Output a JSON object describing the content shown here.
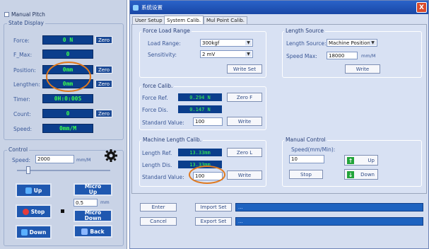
{
  "left": {
    "manual_pitch": "Manual Pitch",
    "state_display": "State Display",
    "rows": [
      {
        "label": "Force:",
        "value": "0 N",
        "zero": "Zero"
      },
      {
        "label": "F_Max:",
        "value": "0",
        "zero": ""
      },
      {
        "label": "Position:",
        "value": "0mm",
        "zero": "Zero"
      },
      {
        "label": "Lengthen:",
        "value": "0mm",
        "zero": "Zero"
      },
      {
        "label": "Timer:",
        "value": "0H:0:00S",
        "zero": ""
      },
      {
        "label": "Count:",
        "value": "0",
        "zero": "Zero"
      },
      {
        "label": "Speed:",
        "value": "0mm/M",
        "zero": ""
      }
    ],
    "control": {
      "title": "Control",
      "speed_label": "Speed:",
      "speed_value": "2000",
      "speed_unit": "mm/M",
      "slider_level": 0.12,
      "micro_value": "0.5",
      "micro_unit": "mm",
      "up": "Up",
      "stop": "Stop",
      "down": "Down",
      "micro_up_1": "Micro",
      "micro_up_2": "Up",
      "micro_down_1": "Micro",
      "micro_down_2": "Down",
      "back": "Back"
    }
  },
  "window": {
    "title": "系统设置",
    "close": "X",
    "tabs": [
      "User Setup",
      "System Calib.",
      "Mul Point Calib."
    ],
    "active_tab": 1,
    "force_load": {
      "title": "Force Load Range",
      "load_range_label": "Load Range:",
      "load_range_value": "300kgf",
      "sensitivity_label": "Sensitivity:",
      "sensitivity_value": "2 mV",
      "write_set": "Write Set"
    },
    "length_source": {
      "title": "Length Source",
      "source_label": "Length Source:",
      "source_value": "Machine Position",
      "speed_max_label": "Speed Max:",
      "speed_max_value": "18000",
      "speed_max_unit": "mm/M",
      "write": "Write"
    },
    "force_calib": {
      "title": "force Calib.",
      "ref_label": "Force Ref.",
      "ref_value": "0.294 N",
      "dis_label": "Force Dis.",
      "dis_value": "0.147 N",
      "std_label": "Standard Value:",
      "std_value": "100",
      "zero_f": "Zero F",
      "write": "Write"
    },
    "machine_length": {
      "title": "Machine Length Calib.",
      "ref_label": "Length Ref.",
      "ref_value": "13.33mm",
      "dis_label": "Length Dis.",
      "dis_value": "13.33mm",
      "std_label": "Standard Value:",
      "std_value": "100",
      "zero_l": "Zero L",
      "write": "Write"
    },
    "manual_control": {
      "title": "Manual Control",
      "speed_label": "Speed(mm/Min):",
      "speed_value": "10",
      "up": "Up",
      "stop": "Stop",
      "down": "Down"
    },
    "bottom": {
      "enter": "Enter",
      "import_set": "Import Set",
      "cancel": "Cancel",
      "export_set": "Export Set",
      "field1": "...",
      "field2": "..."
    }
  },
  "colors": {
    "lcd_bg": "#0b3e8c",
    "lcd_text": "#39ff4e",
    "highlight_ring": "#e07a1f",
    "title_bar": "#1947a6"
  }
}
